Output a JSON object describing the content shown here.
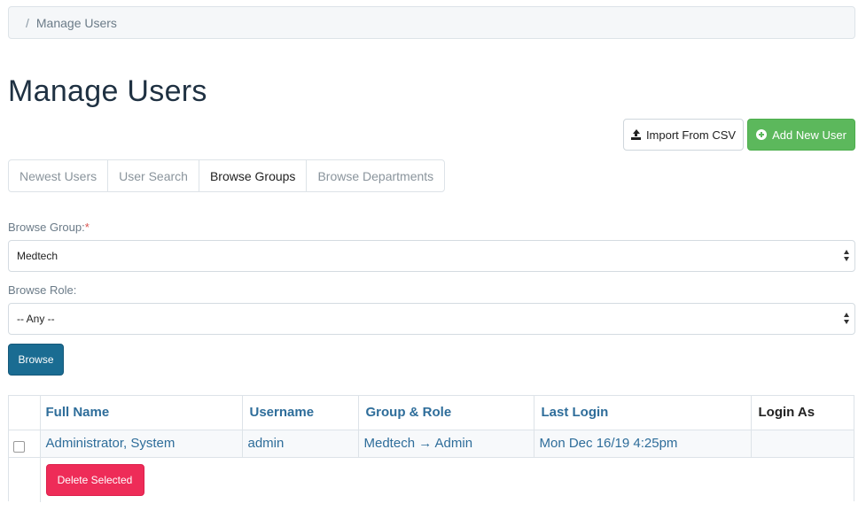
{
  "breadcrumb": {
    "separator": "/",
    "current": "Manage Users"
  },
  "page": {
    "title": "Manage Users"
  },
  "actions": {
    "import_label": "Import From CSV",
    "add_label": "Add New User"
  },
  "tabs": [
    {
      "label": "Newest Users",
      "active": false
    },
    {
      "label": "User Search",
      "active": false
    },
    {
      "label": "Browse Groups",
      "active": true
    },
    {
      "label": "Browse Departments",
      "active": false
    }
  ],
  "form": {
    "group_label": "Browse Group:",
    "required_mark": "*",
    "group_value": "Medtech",
    "role_label": "Browse Role:",
    "role_value": "-- Any --",
    "browse_label": "Browse"
  },
  "table": {
    "headers": [
      "Full Name",
      "Username",
      "Group & Role",
      "Last Login",
      "Login As"
    ],
    "rows": [
      {
        "full_name": "Administrator, System",
        "username": "admin",
        "group_role": "Medtech → Admin",
        "last_login": "Mon Dec 16/19 4:25pm",
        "login_as": ""
      }
    ],
    "delete_label": "Delete Selected"
  },
  "colors": {
    "primary": "#1a6c92",
    "success": "#5cb85c",
    "danger": "#ee2c58",
    "link": "#2e6d9a"
  }
}
